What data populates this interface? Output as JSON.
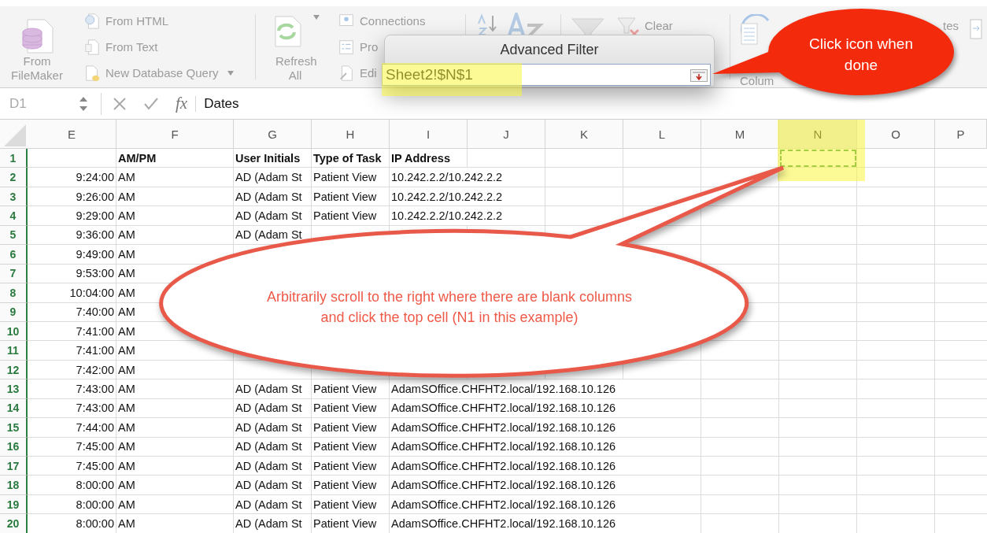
{
  "ribbon": {
    "from_filemaker": "From FileMaker",
    "get_data_items": [
      {
        "label": "From HTML",
        "kind": "globe"
      },
      {
        "label": "From Text",
        "kind": "text"
      },
      {
        "label": "New Database Query",
        "kind": "database",
        "caret": true
      }
    ],
    "refresh": "Refresh All",
    "connection_items": [
      {
        "label": "Connections",
        "kind": "connections"
      },
      {
        "label": "Pro",
        "kind": "properties"
      },
      {
        "label": "Edi",
        "kind": "links"
      }
    ],
    "clear": "Clear",
    "text_to_columns": "Colum",
    "cut_label": "tes"
  },
  "formula_bar": {
    "name_box": "D1",
    "function_label": "fx",
    "formula": "Dates"
  },
  "dialog": {
    "title": "Advanced Filter",
    "value": "Sheet2!$N$1"
  },
  "columns": [
    {
      "label": "E",
      "selected": false
    },
    {
      "label": "F",
      "selected": false
    },
    {
      "label": "G",
      "selected": false
    },
    {
      "label": "H",
      "selected": false
    },
    {
      "label": "I",
      "selected": false
    },
    {
      "label": "J",
      "selected": false
    },
    {
      "label": "K",
      "selected": false
    },
    {
      "label": "L",
      "selected": false
    },
    {
      "label": "M",
      "selected": false
    },
    {
      "label": "N",
      "selected": true
    },
    {
      "label": "O",
      "selected": false
    },
    {
      "label": "P",
      "selected": false
    }
  ],
  "rows": [
    {
      "number": "1",
      "kind": "header",
      "am_pm": "AM/PM",
      "user": "User Initials",
      "task": "Type of Task",
      "ip": "IP Address"
    },
    {
      "number": "2",
      "kind": "data",
      "time": "9:24:00",
      "am_pm": "AM",
      "user": "AD (Adam St",
      "task": "Patient View",
      "ip": "10.242.2.2/10.242.2.2"
    },
    {
      "number": "3",
      "kind": "data",
      "time": "9:26:00",
      "am_pm": "AM",
      "user": "AD (Adam St",
      "task": "Patient View",
      "ip": "10.242.2.2/10.242.2.2"
    },
    {
      "number": "4",
      "kind": "data",
      "time": "9:29:00",
      "am_pm": "AM",
      "user": "AD (Adam St",
      "task": "Patient View",
      "ip": "10.242.2.2/10.242.2.2"
    },
    {
      "number": "5",
      "kind": "data",
      "time": "9:36:00",
      "am_pm": "AM",
      "user": "AD (Adam St"
    },
    {
      "number": "6",
      "kind": "data",
      "time": "9:49:00",
      "am_pm": "AM"
    },
    {
      "number": "7",
      "kind": "data",
      "time": "9:53:00",
      "am_pm": "AM"
    },
    {
      "number": "8",
      "kind": "data",
      "time": "10:04:00",
      "am_pm": "AM"
    },
    {
      "number": "9",
      "kind": "data",
      "time": "7:40:00",
      "am_pm": "AM"
    },
    {
      "number": "10",
      "kind": "data",
      "time": "7:41:00",
      "am_pm": "AM"
    },
    {
      "number": "11",
      "kind": "data",
      "time": "7:41:00",
      "am_pm": "AM"
    },
    {
      "number": "12",
      "kind": "data",
      "time": "7:42:00",
      "am_pm": "AM"
    },
    {
      "number": "13",
      "kind": "data",
      "time": "7:43:00",
      "am_pm": "AM",
      "user": "AD (Adam St",
      "task": "Patient View",
      "ip": "AdamSOffice.CHFHT2.local/192.168.10.126"
    },
    {
      "number": "14",
      "kind": "data",
      "time": "7:43:00",
      "am_pm": "AM",
      "user": "AD (Adam St",
      "task": "Patient View",
      "ip": "AdamSOffice.CHFHT2.local/192.168.10.126"
    },
    {
      "number": "15",
      "kind": "data",
      "time": "7:44:00",
      "am_pm": "AM",
      "user": "AD (Adam St",
      "task": "Patient View",
      "ip": "AdamSOffice.CHFHT2.local/192.168.10.126"
    },
    {
      "number": "16",
      "kind": "data",
      "time": "7:45:00",
      "am_pm": "AM",
      "user": "AD (Adam St",
      "task": "Patient View",
      "ip": "AdamSOffice.CHFHT2.local/192.168.10.126"
    },
    {
      "number": "17",
      "kind": "data",
      "time": "7:45:00",
      "am_pm": "AM",
      "user": "AD (Adam St",
      "task": "Patient View",
      "ip": "AdamSOffice.CHFHT2.local/192.168.10.126"
    },
    {
      "number": "18",
      "kind": "data",
      "time": "8:00:00",
      "am_pm": "AM",
      "user": "AD (Adam St",
      "task": "Patient View",
      "ip": "AdamSOffice.CHFHT2.local/192.168.10.126"
    },
    {
      "number": "19",
      "kind": "data",
      "time": "8:00:00",
      "am_pm": "AM",
      "user": "AD (Adam St",
      "task": "Patient View",
      "ip": "AdamSOffice.CHFHT2.local/192.168.10.126"
    },
    {
      "number": "20",
      "kind": "data",
      "time": "8:00:00",
      "am_pm": "AM",
      "user": "AD (Adam St",
      "task": "Patient View",
      "ip": "AdamSOffice.CHFHT2.local/192.168.10.126"
    }
  ],
  "callouts": [
    {
      "kind": "red",
      "text": "Click icon when done"
    },
    {
      "kind": "white",
      "text": "Arbitrarily scroll to the right where there are blank columns and click the top cell (N1 in this example)"
    }
  ]
}
